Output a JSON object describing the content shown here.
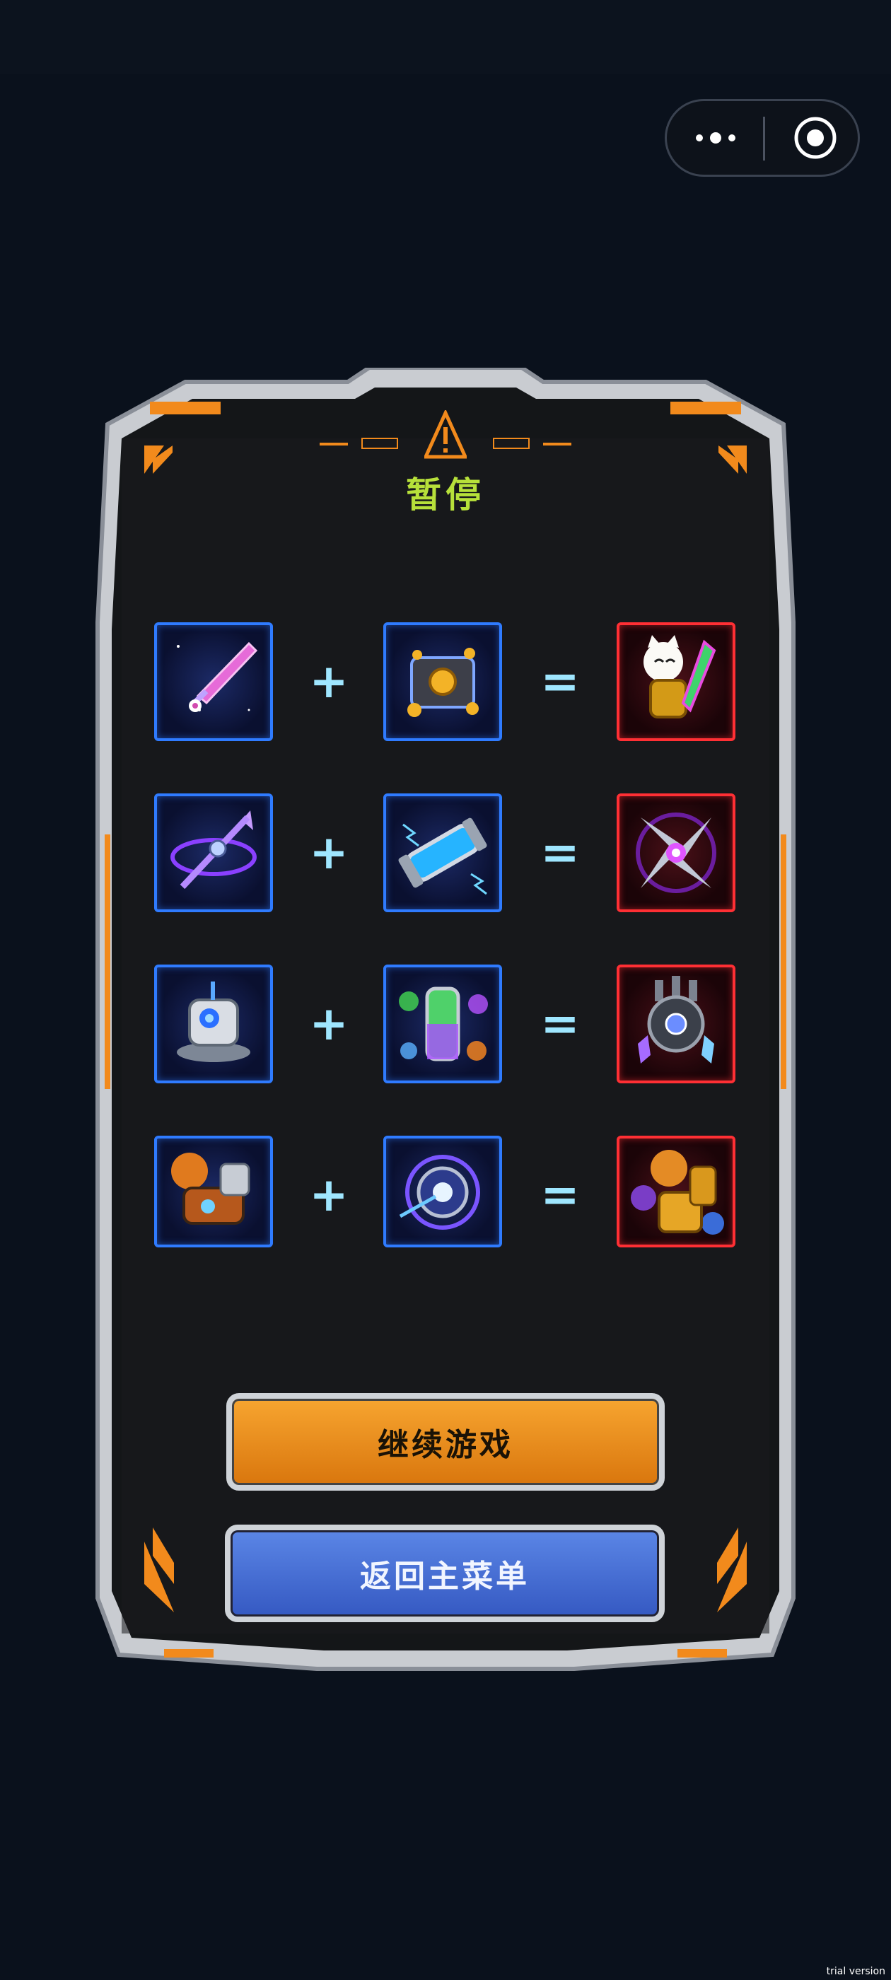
{
  "capsule": {
    "more_icon": "more-dots-icon",
    "close_icon": "target-icon"
  },
  "panel": {
    "title": "暂停",
    "warning_icon": "warning-triangle-icon",
    "plus_symbol": "+",
    "equals_symbol": "=",
    "recipes": [
      {
        "a_icon": "pink-sword-icon",
        "b_icon": "gold-coin-chest-icon",
        "result_icon": "lucky-cat-gauntlet-icon"
      },
      {
        "a_icon": "purple-arrow-orb-icon",
        "b_icon": "blue-energy-capsule-icon",
        "result_icon": "purple-shuriken-icon"
      },
      {
        "a_icon": "turret-robot-icon",
        "b_icon": "elemental-tube-icon",
        "result_icon": "crystal-mech-orb-icon"
      },
      {
        "a_icon": "tiger-gauntlet-icon",
        "b_icon": "blue-laser-orb-icon",
        "result_icon": "beast-fist-icon"
      }
    ],
    "colors": {
      "input_border": "#2f7bff",
      "result_border": "#ff2f34",
      "title": "#b7e03a",
      "frame_accent": "#f28a1c"
    }
  },
  "buttons": {
    "continue_label": "继续游戏",
    "menu_label": "返回主菜单"
  },
  "watermark": "trial version"
}
